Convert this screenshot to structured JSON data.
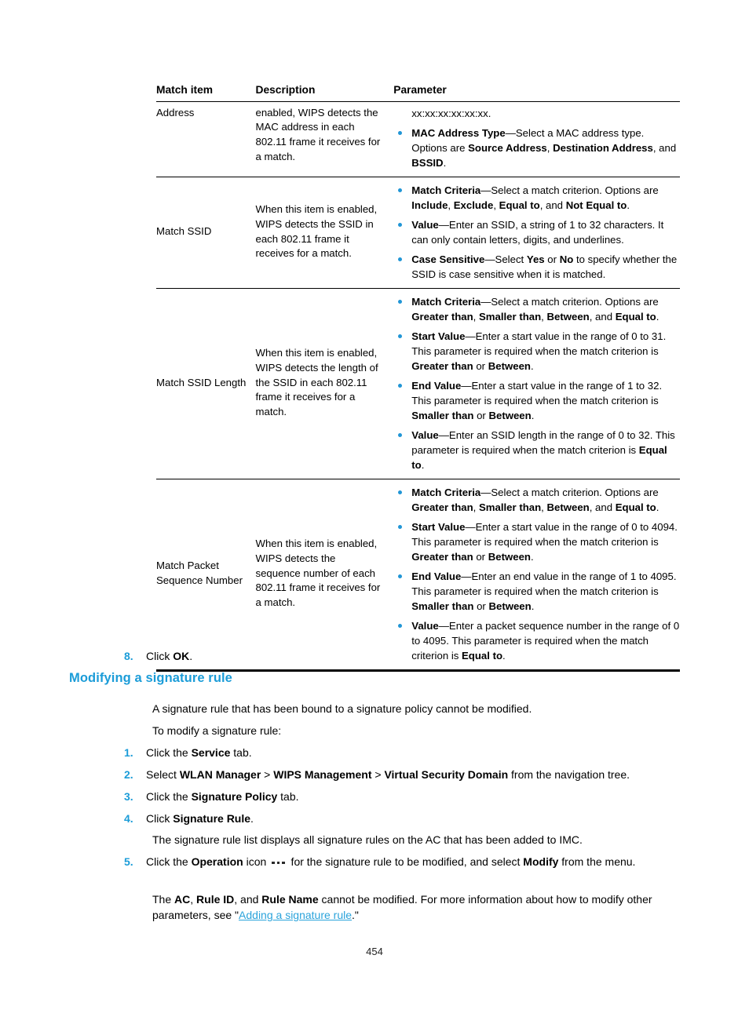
{
  "colors": {
    "accent_blue": "#1b9cd8",
    "bullet_blue": "#2196d6",
    "link_blue": "#2aa3db",
    "text": "#000000"
  },
  "table": {
    "headers": {
      "match_item": "Match item",
      "description": "Description",
      "parameter": "Parameter"
    },
    "rows": [
      {
        "match_item": "Address",
        "description": "enabled, WIPS detects the MAC address in each 802.11 frame it receives for a match.",
        "parameters": [
          {
            "bullet": false,
            "label": "",
            "text": "xx:xx:xx:xx:xx:xx."
          },
          {
            "bullet": true,
            "label": "MAC Address Type",
            "text": "—Select a MAC address type. Options are ",
            "bold_runs": [
              "Source Address",
              "Destination Address",
              "BSSID"
            ],
            "tail_joiners": [
              ", ",
              ", and ",
              "."
            ]
          }
        ]
      },
      {
        "match_item": "Match SSID",
        "description": "When this item is enabled, WIPS detects the SSID in each 802.11 frame it receives for a match.",
        "parameters": [
          {
            "bullet": true,
            "label": "Match Criteria",
            "text": "—Select a match criterion. Options are ",
            "bold_runs": [
              "Include",
              "Exclude",
              "Equal to",
              "Not Equal to"
            ],
            "tail_joiners": [
              ", ",
              ", ",
              ", and ",
              "."
            ]
          },
          {
            "bullet": true,
            "label": "Value",
            "text": "—Enter an SSID, a string of 1 to 32 characters. It can only contain letters, digits, and underlines."
          },
          {
            "bullet": true,
            "label": "Case Sensitive",
            "text": "—Select ",
            "bold_runs": [
              "Yes",
              "No"
            ],
            "tail_joiners": [
              " or ",
              " to specify whether the SSID is case sensitive when it is matched."
            ]
          }
        ]
      },
      {
        "match_item": "Match SSID Length",
        "description": "When this item is enabled, WIPS detects the length of the SSID in each 802.11 frame it receives for a match.",
        "parameters": [
          {
            "bullet": true,
            "label": "Match Criteria",
            "text": "—Select a match criterion. Options are ",
            "bold_runs": [
              "Greater than",
              "Smaller than",
              "Between",
              "Equal to"
            ],
            "tail_joiners": [
              ", ",
              ", ",
              ", and ",
              "."
            ]
          },
          {
            "bullet": true,
            "label": "Start Value",
            "text": "—Enter a start value in the range of 0 to 31. This parameter is required when the match criterion is ",
            "bold_runs": [
              "Greater than",
              "Between"
            ],
            "tail_joiners": [
              " or ",
              "."
            ]
          },
          {
            "bullet": true,
            "label": "End Value",
            "text": "—Enter a start value in the range of 1 to 32. This parameter is required when the match criterion is ",
            "bold_runs": [
              "Smaller than",
              "Between"
            ],
            "tail_joiners": [
              " or ",
              "."
            ]
          },
          {
            "bullet": true,
            "label": "Value",
            "text": "—Enter an SSID length in the range of 0 to 32. This parameter is required when the match criterion is ",
            "bold_runs": [
              "Equal to"
            ],
            "tail_joiners": [
              "."
            ]
          }
        ]
      },
      {
        "match_item": "Match Packet Sequence Number",
        "description": "When this item is enabled, WIPS detects the sequence number of each 802.11 frame it receives for a match.",
        "parameters": [
          {
            "bullet": true,
            "label": "Match Criteria",
            "text": "—Select a match criterion. Options are ",
            "bold_runs": [
              "Greater than",
              "Smaller than",
              "Between",
              "Equal to"
            ],
            "tail_joiners": [
              ", ",
              ", ",
              ", and ",
              "."
            ]
          },
          {
            "bullet": true,
            "label": "Start Value",
            "text": "—Enter a start value in the range of 0 to 4094. This parameter is required when the match criterion is ",
            "bold_runs": [
              "Greater than",
              "Between"
            ],
            "tail_joiners": [
              " or ",
              "."
            ]
          },
          {
            "bullet": true,
            "label": "End Value",
            "text": "—Enter an end value in the range of 1 to 4095. This parameter is required when the match criterion is ",
            "bold_runs": [
              "Smaller than",
              "Between"
            ],
            "tail_joiners": [
              " or ",
              "."
            ]
          },
          {
            "bullet": true,
            "label": "Value",
            "text": "—Enter a packet sequence number in the range of 0 to 4095. This parameter is required when the match criterion is ",
            "bold_runs": [
              "Equal to"
            ],
            "tail_joiners": [
              "."
            ]
          }
        ]
      }
    ]
  },
  "body": {
    "step8": {
      "num": "8.",
      "pre": "Click ",
      "bold": "OK",
      "post": "."
    },
    "heading": "Modifying a signature rule",
    "intro": "A signature rule that has been bound to a signature policy cannot be modified.",
    "lead_in": "To modify a signature rule:",
    "step1": {
      "num": "1.",
      "pre": "Click the ",
      "bold": "Service",
      "post": " tab."
    },
    "step2": {
      "num": "2.",
      "pre": "Select ",
      "bold1": "WLAN Manager",
      "sep1": " > ",
      "bold2": "WIPS Management",
      "sep2": " > ",
      "bold3": "Virtual Security Domain",
      "post": " from the navigation tree."
    },
    "step3": {
      "num": "3.",
      "pre": "Click the ",
      "bold": "Signature Policy",
      "post": " tab."
    },
    "step4": {
      "num": "4.",
      "pre": "Click ",
      "bold": "Signature Rule",
      "post": "."
    },
    "step4_note": "The signature rule list displays all signature rules on the AC that has been added to IMC.",
    "step5": {
      "num": "5.",
      "pre": "Click the ",
      "bold1": "Operation",
      "mid1": " icon ",
      "icon": "operation-ellipsis-icon",
      "mid2": " for the signature rule to be modified, and select ",
      "bold2": "Modify",
      "post": " from the menu."
    },
    "step5_note": {
      "pre": "The ",
      "bold1": "AC",
      "sep1": ", ",
      "bold2": "Rule ID",
      "sep2": ", and ",
      "bold3": "Rule Name",
      "mid": " cannot be modified. For more information about how to modify other parameters, see \"",
      "link": "Adding a signature rule",
      "post": ".\""
    }
  },
  "footer": {
    "page_number": "454"
  }
}
